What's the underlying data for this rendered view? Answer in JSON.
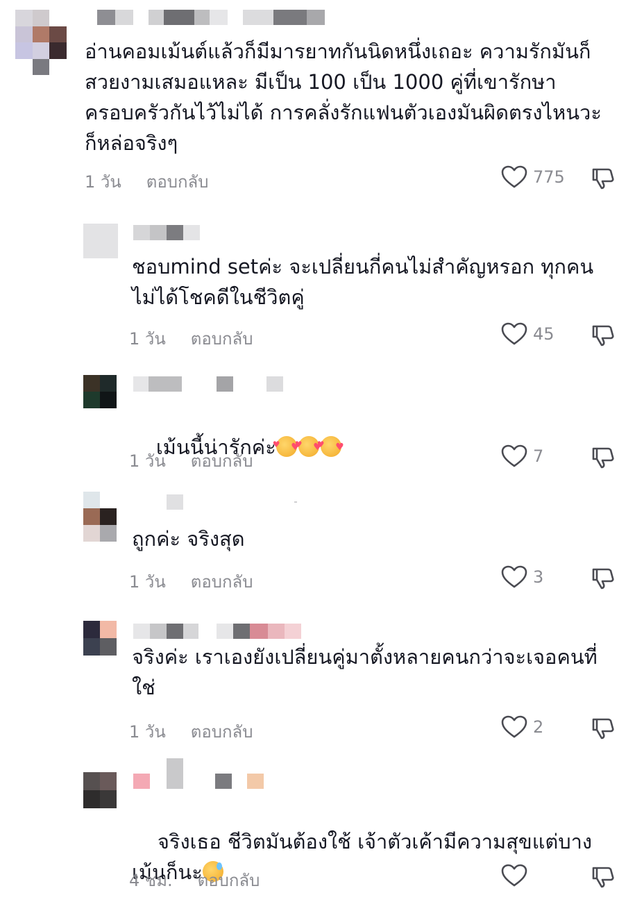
{
  "comments": [
    {
      "text": "อ่านคอมเม้นต์แล้วก็มีมารยาทกันนิดหนึ่งเถอะ ความรักมันก็สวยงามเสมอแหละ มีเป็น 100 เป็น 1000 คู่ที่เขารักษาครอบครัวกันไว้ไม่ได้ การคลั่งรักแฟนตัวเองมันผิดตรงไหนวะ ก็หล่อจริงๆ",
      "time": "1 วัน",
      "reply": "ตอบกลับ",
      "likes": "775"
    },
    {
      "text": "ชอบmind setค่ะ จะเปลี่ยนกี่คนไม่สำคัญหรอก ทุกคนไม่ได้โชคดีในชีวิตคู่",
      "time": "1 วัน",
      "reply": "ตอบกลับ",
      "likes": "45"
    },
    {
      "text": "เม้นนี้น่ารักค่ะ",
      "time": "1 วัน",
      "reply": "ตอบกลับ",
      "likes": "7",
      "emoji": "smiling-face-with-hearts"
    },
    {
      "text": "ถูกค่ะ จริงสุด",
      "time": "1 วัน",
      "reply": "ตอบกลับ",
      "likes": "3"
    },
    {
      "text": "จริงค่ะ เราเองยังเปลี่ยนคู่มาตั้งหลายคนกว่าจะเจอคนที่ใช่",
      "time": "1 วัน",
      "reply": "ตอบกลับ",
      "likes": "2"
    },
    {
      "text": "จริงเธอ ชีวิตมันต้องใช้ เจ้าตัวเค้ามีความสุขแต่บางเม้นก็นะ",
      "time": "4 ชม.",
      "reply": "ตอบกลับ",
      "likes": "",
      "emoji": "grinning-face-with-sweat"
    }
  ],
  "icons": {
    "like": "heart-outline-icon",
    "dislike": "thumbs-down-icon"
  },
  "colors": {
    "text": "#161823",
    "meta": "#8a8b91"
  }
}
